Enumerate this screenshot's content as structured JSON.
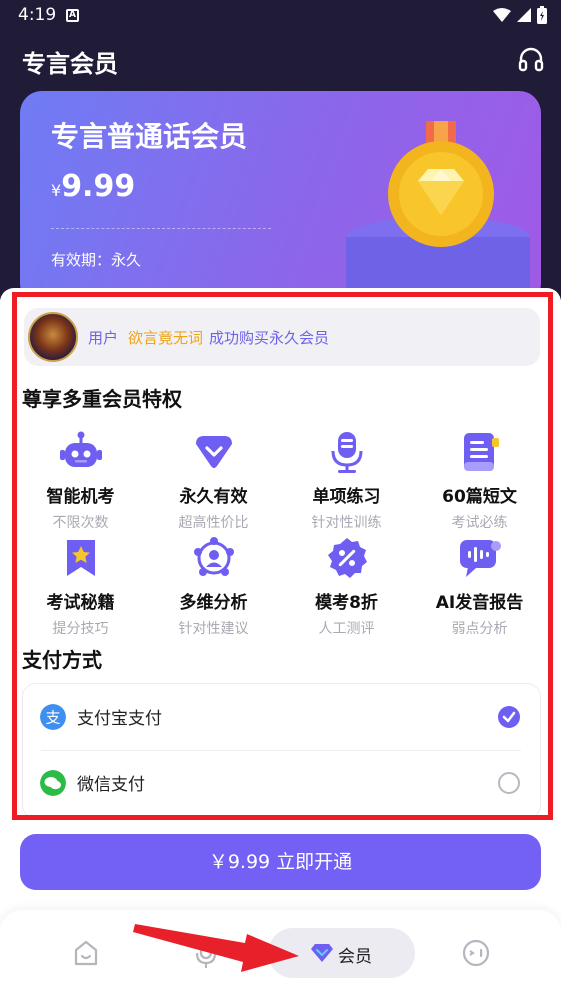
{
  "status_bar": {
    "time": "4:19",
    "notif_letter": "A"
  },
  "header": {
    "title": "专言会员",
    "support_icon": "headset-icon"
  },
  "membership_card": {
    "title": "专言普通话会员",
    "currency": "¥",
    "price": "9.99",
    "validity": "有效期：永久"
  },
  "notice": {
    "prefix": "用户",
    "username": "欲言竟无词",
    "suffix": "成功购买永久会员"
  },
  "features_title": "尊享多重会员特权",
  "features": [
    {
      "name": "智能机考",
      "desc": "不限次数",
      "icon": "robot-icon"
    },
    {
      "name": "永久有效",
      "desc": "超高性价比",
      "icon": "diamond-icon"
    },
    {
      "name": "单项练习",
      "desc": "针对性训练",
      "icon": "microphone-icon"
    },
    {
      "name": "60篇短文",
      "desc": "考试必练",
      "icon": "document-icon"
    },
    {
      "name": "考试秘籍",
      "desc": "提分技巧",
      "icon": "bookmark-star-icon"
    },
    {
      "name": "多维分析",
      "desc": "针对性建议",
      "icon": "network-icon"
    },
    {
      "name": "模考8折",
      "desc": "人工测评",
      "icon": "discount-badge-icon"
    },
    {
      "name": "AI发音报告",
      "desc": "弱点分析",
      "icon": "voice-report-icon"
    }
  ],
  "payment": {
    "title": "支付方式",
    "methods": [
      {
        "label": "支付宝支付",
        "icon": "alipay-icon",
        "selected": true
      },
      {
        "label": "微信支付",
        "icon": "wechat-icon",
        "selected": false
      }
    ]
  },
  "buy_button": "￥9.99 立即开通",
  "tabbar": {
    "active_label": "会员",
    "tabs": [
      "home-icon",
      "microphone-icon",
      "vip-diamond-icon",
      "face-icon"
    ]
  },
  "colors": {
    "accent": "#7360f5",
    "header_bg": "#201c38",
    "highlight_border": "#ee1c25",
    "username": "#efa316"
  }
}
